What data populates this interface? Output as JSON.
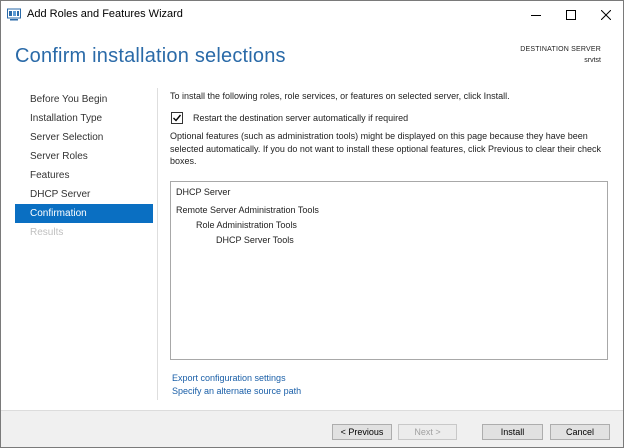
{
  "window": {
    "title": "Add Roles and Features Wizard"
  },
  "header": {
    "page_title": "Confirm installation selections",
    "destination_label": "DESTINATION SERVER",
    "destination_server": "srvtst"
  },
  "nav": {
    "items": [
      {
        "label": "Before You Begin",
        "state": "normal"
      },
      {
        "label": "Installation Type",
        "state": "normal"
      },
      {
        "label": "Server Selection",
        "state": "normal"
      },
      {
        "label": "Server Roles",
        "state": "normal"
      },
      {
        "label": "Features",
        "state": "normal"
      },
      {
        "label": "DHCP Server",
        "state": "normal"
      },
      {
        "label": "Confirmation",
        "state": "active"
      },
      {
        "label": "Results",
        "state": "disabled"
      }
    ]
  },
  "main": {
    "intro": "To install the following roles, role services, or features on selected server, click Install.",
    "restart_checkbox": {
      "label": "Restart the destination server automatically if required",
      "checked": true
    },
    "optional_note": "Optional features (such as administration tools) might be displayed on this page because they have been selected automatically. If you do not want to install these optional features, click Previous to clear their check boxes.",
    "selections": [
      {
        "label": "DHCP Server",
        "level": 0
      },
      {
        "label": "Remote Server Administration Tools",
        "level": 0
      },
      {
        "label": "Role Administration Tools",
        "level": 1
      },
      {
        "label": "DHCP Server Tools",
        "level": 2
      }
    ],
    "links": {
      "export": "Export configuration settings",
      "alternate_source": "Specify an alternate source path"
    }
  },
  "footer": {
    "previous_label": "< Previous",
    "next_label": "Next >",
    "install_label": "Install",
    "cancel_label": "Cancel"
  },
  "colors": {
    "accent": "#0a6fc2",
    "title": "#2a6aa8",
    "link": "#1a5fa8"
  }
}
